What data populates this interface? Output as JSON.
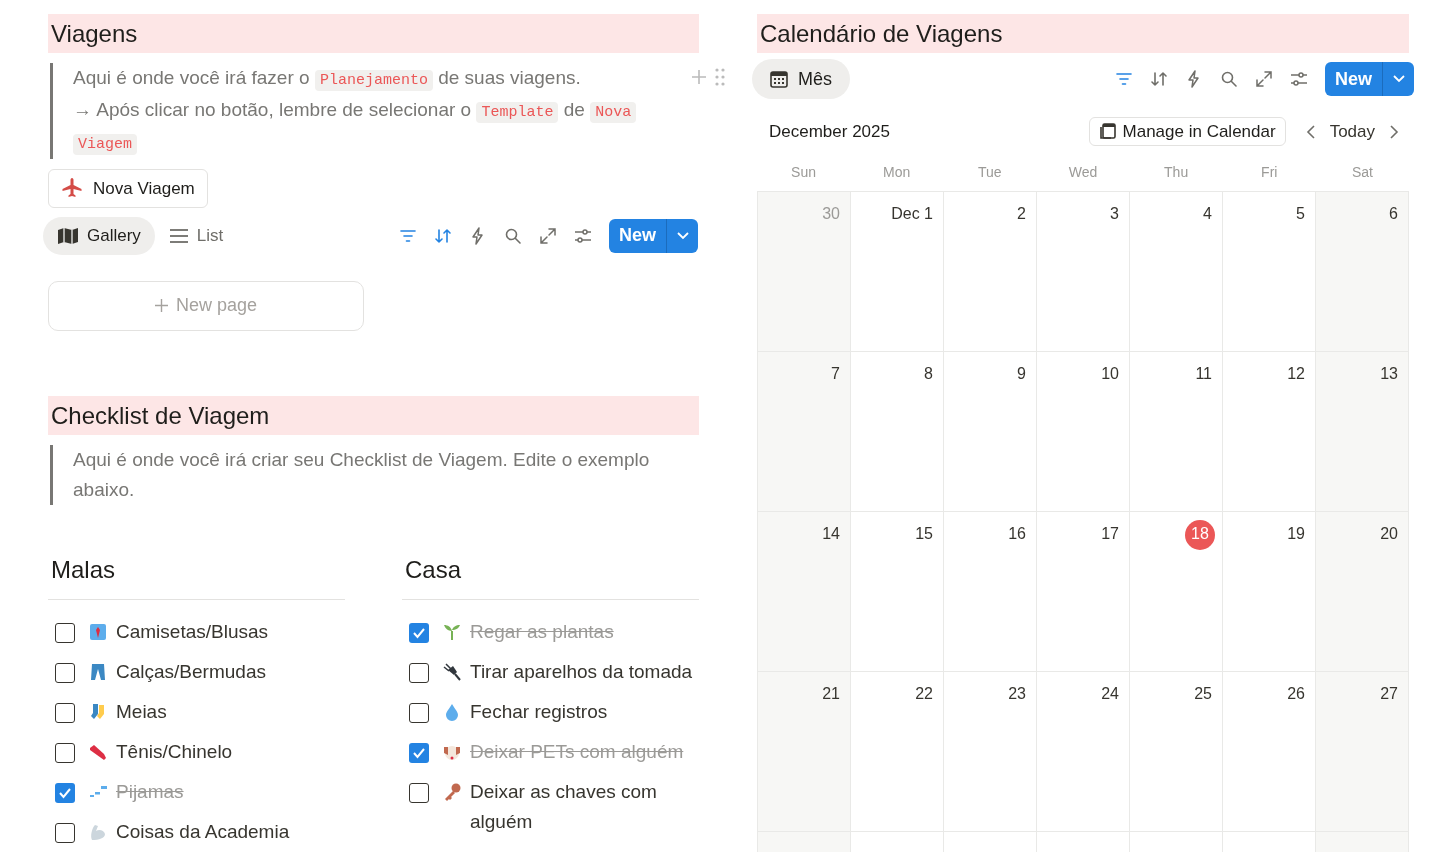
{
  "viagens": {
    "title": "Viagens",
    "callout_lines": [
      [
        {
          "text": "Aqui é onde você irá fazer o ",
          "code": false
        },
        {
          "text": "Planejamento",
          "code": true
        },
        {
          "text": " de suas viagens.",
          "code": false
        }
      ],
      [
        {
          "text": "→ Após clicar no botão, lembre de selecionar o ",
          "code": false
        },
        {
          "text": "Template",
          "code": true
        },
        {
          "text": " de ",
          "code": false
        },
        {
          "text": "Nova Viagem",
          "code": true
        }
      ]
    ],
    "button": "Nova Viagem",
    "views": [
      {
        "label": "Gallery",
        "selected": true
      },
      {
        "label": "List",
        "selected": false
      }
    ],
    "toolbar": {
      "filter_active": true,
      "sort_active": true,
      "new_label": "New"
    },
    "new_page": "New page"
  },
  "checklist": {
    "title": "Checklist de Viagem",
    "callout": "Aqui é onde você irá criar seu Checklist de Viagem. Edite o exemplo abaixo.",
    "columns": [
      {
        "title": "Malas",
        "items": [
          {
            "label": "Camisetas/Blusas",
            "checked": false
          },
          {
            "label": "Calças/Bermudas",
            "checked": false
          },
          {
            "label": "Meias",
            "checked": false
          },
          {
            "label": "Tênis/Chinelo",
            "checked": false
          },
          {
            "label": "Pijamas",
            "checked": true
          },
          {
            "label": "Coisas da Academia",
            "checked": false
          }
        ]
      },
      {
        "title": "Casa",
        "items": [
          {
            "label": "Regar as plantas",
            "checked": true
          },
          {
            "label": "Tirar aparelhos da tomada",
            "checked": false
          },
          {
            "label": "Fechar registros",
            "checked": false
          },
          {
            "label": "Deixar PETs com alguém",
            "checked": true
          },
          {
            "label": "Deixar as chaves com alguém",
            "checked": false
          }
        ]
      }
    ]
  },
  "calendar": {
    "title": "Calendário de Viagens",
    "view": "Mês",
    "toolbar": {
      "filter_active": true,
      "sort_active": false,
      "new_label": "New"
    },
    "month": "December 2025",
    "manage": "Manage in Calendar",
    "today": "Today",
    "weekdays": [
      "Sun",
      "Mon",
      "Tue",
      "Wed",
      "Thu",
      "Fri",
      "Sat"
    ],
    "weeks": [
      [
        {
          "label": "30",
          "outside": true,
          "selected": false
        },
        {
          "label": "Dec 1",
          "outside": false,
          "selected": false
        },
        {
          "label": "2",
          "outside": false,
          "selected": false
        },
        {
          "label": "3",
          "outside": false,
          "selected": false
        },
        {
          "label": "4",
          "outside": false,
          "selected": false
        },
        {
          "label": "5",
          "outside": false,
          "selected": false
        },
        {
          "label": "6",
          "outside": false,
          "selected": false
        }
      ],
      [
        {
          "label": "7",
          "outside": false,
          "selected": false
        },
        {
          "label": "8",
          "outside": false,
          "selected": false
        },
        {
          "label": "9",
          "outside": false,
          "selected": false
        },
        {
          "label": "10",
          "outside": false,
          "selected": false
        },
        {
          "label": "11",
          "outside": false,
          "selected": false
        },
        {
          "label": "12",
          "outside": false,
          "selected": false
        },
        {
          "label": "13",
          "outside": false,
          "selected": false
        }
      ],
      [
        {
          "label": "14",
          "outside": false,
          "selected": false
        },
        {
          "label": "15",
          "outside": false,
          "selected": false
        },
        {
          "label": "16",
          "outside": false,
          "selected": false
        },
        {
          "label": "17",
          "outside": false,
          "selected": false
        },
        {
          "label": "18",
          "outside": false,
          "selected": true
        },
        {
          "label": "19",
          "outside": false,
          "selected": false
        },
        {
          "label": "20",
          "outside": false,
          "selected": false
        }
      ],
      [
        {
          "label": "21",
          "outside": false,
          "selected": false
        },
        {
          "label": "22",
          "outside": false,
          "selected": false
        },
        {
          "label": "23",
          "outside": false,
          "selected": false
        },
        {
          "label": "24",
          "outside": false,
          "selected": false
        },
        {
          "label": "25",
          "outside": false,
          "selected": false
        },
        {
          "label": "26",
          "outside": false,
          "selected": false
        },
        {
          "label": "27",
          "outside": false,
          "selected": false
        }
      ]
    ]
  }
}
